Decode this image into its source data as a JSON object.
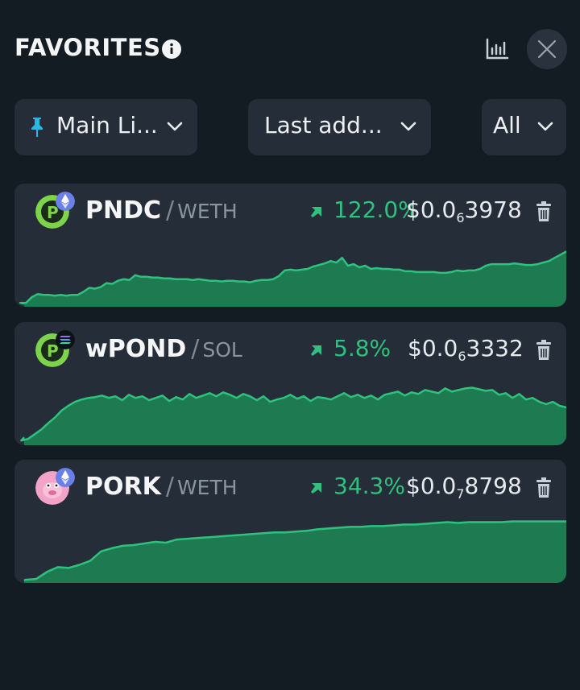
{
  "header": {
    "title": "FAVORITES",
    "info_icon": "info-icon",
    "chart_icon": "bar-chart-icon",
    "close_icon": "close-icon"
  },
  "filters": {
    "list": {
      "label": "Main Li...",
      "icon": "pin-icon"
    },
    "sort": {
      "label": "Last add..."
    },
    "chain": {
      "label": "All"
    }
  },
  "colors": {
    "accent_green": "#2ec27e",
    "chart_fill": "#1e7a50",
    "card_bg": "#252e38",
    "page_bg": "#141c23"
  },
  "favorites": [
    {
      "symbol": "PNDC",
      "quote": "WETH",
      "change": "122.0%",
      "price_prefix": "$0.0",
      "price_zeros": "6",
      "price_digits": "3978",
      "chain": "ethereum",
      "sparkline": [
        4,
        5,
        5,
        12,
        16,
        15,
        15,
        14,
        15,
        14,
        15,
        15,
        19,
        24,
        23,
        25,
        30,
        29,
        33,
        35,
        34,
        40,
        38,
        38,
        37,
        37,
        36,
        36,
        35,
        35,
        35,
        34,
        35,
        34,
        33,
        33,
        32,
        33,
        33,
        32,
        32,
        31,
        33,
        34,
        34,
        35,
        39,
        46,
        47,
        46,
        47,
        48,
        51,
        53,
        55,
        58,
        56,
        62,
        52,
        54,
        50,
        52,
        48,
        49,
        48,
        48,
        47,
        47,
        45,
        45,
        44,
        44,
        44,
        44,
        43,
        43,
        44,
        46,
        45,
        46,
        46,
        48,
        52,
        54,
        54,
        54,
        54,
        55,
        54,
        53,
        53,
        54,
        56,
        58,
        62,
        66,
        70
      ]
    },
    {
      "symbol": "wPOND",
      "quote": "SOL",
      "change": "5.8%",
      "price_prefix": "$0.0",
      "price_zeros": "6",
      "price_digits": "3332",
      "chain": "solana",
      "sparkline": [
        10,
        6,
        8,
        14,
        20,
        28,
        35,
        44,
        50,
        55,
        58,
        60,
        61,
        63,
        60,
        62,
        57,
        64,
        60,
        62,
        57,
        60,
        63,
        56,
        61,
        58,
        65,
        60,
        63,
        66,
        62,
        67,
        64,
        60,
        65,
        62,
        57,
        62,
        55,
        58,
        60,
        64,
        59,
        62,
        56,
        61,
        60,
        58,
        62,
        66,
        61,
        64,
        60,
        63,
        58,
        64,
        66,
        68,
        63,
        67,
        65,
        70,
        68,
        66,
        72,
        68,
        70,
        72,
        73,
        71,
        69,
        70,
        64,
        66,
        60,
        65,
        58,
        60,
        55,
        52,
        55,
        50,
        48
      ]
    },
    {
      "symbol": "PORK",
      "quote": "WETH",
      "change": "34.3%",
      "price_prefix": "$0.0",
      "price_zeros": "7",
      "price_digits": "8798",
      "chain": "ethereum",
      "sparkline": [
        3,
        4,
        5,
        14,
        20,
        19,
        23,
        28,
        40,
        44,
        47,
        48,
        50,
        52,
        51,
        55,
        56,
        57,
        58,
        59,
        60,
        61,
        62,
        63,
        64,
        64,
        65,
        66,
        68,
        69,
        70,
        71,
        71,
        72,
        72,
        73,
        74,
        74,
        75,
        76,
        77,
        76,
        77,
        77,
        77,
        77,
        78,
        78,
        78,
        78,
        78,
        78
      ]
    }
  ]
}
